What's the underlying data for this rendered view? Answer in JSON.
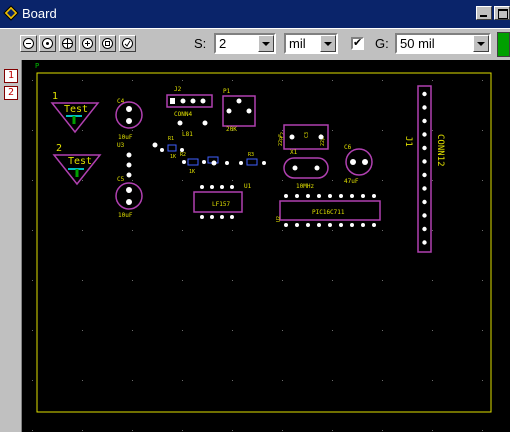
{
  "window": {
    "title": "Board"
  },
  "toolbar": {
    "zoom_buttons": [
      "zoom-out",
      "zoom-fit",
      "zoom-window",
      "zoom-in",
      "zoom-previous",
      "zoom-redraw"
    ],
    "snap_label": "S:",
    "snap_value": "2",
    "unit_value": "mil",
    "grid_checked": "✔",
    "grid_label": "G:",
    "grid_value": "50 mil"
  },
  "layers": [
    "1",
    "2"
  ],
  "board": {
    "origin_marker": "P",
    "components": {
      "test1_num": "1",
      "test1_label": "Test",
      "test2_num": "2",
      "test2_label": "Test",
      "c4": "C4",
      "c4_val": "10uF",
      "u3": "U3",
      "c5": "C5",
      "c5_val": "10uF",
      "j2": "J2",
      "j2_name": "CONN4",
      "p1": "P1",
      "p1_val": "20K",
      "l81": "L81",
      "r1": "R1",
      "r1_val": "1K",
      "r2": "R2",
      "r2_val": "1K",
      "r3": "R3",
      "c2": "C2",
      "c3": "C3",
      "c2_val": "22pF",
      "c3_val": "22pF",
      "x1": "X1",
      "x1_val": "10MHz",
      "c6": "C6",
      "c6_val": "47uF",
      "u1": "U1",
      "u1_val": "LF157",
      "u2": "U2",
      "u2_val": "PIC16C711",
      "j1": "J1",
      "j1_name": "CONN12"
    }
  }
}
